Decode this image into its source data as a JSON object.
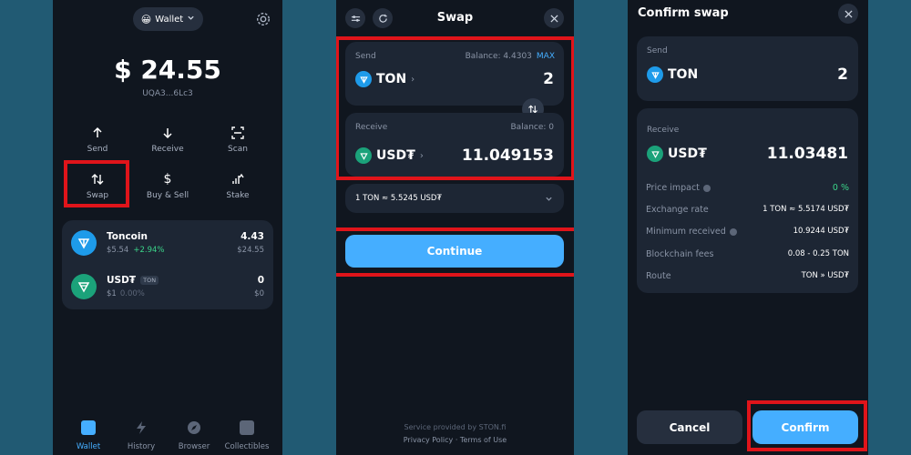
{
  "wallet": {
    "account_label": "Wallet",
    "account_emoji": "😀",
    "balance": "$ 24.55",
    "address": "UQA3...6Lc3",
    "actions": [
      {
        "label": "Send",
        "icon": "arrow-up-icon"
      },
      {
        "label": "Receive",
        "icon": "arrow-down-icon"
      },
      {
        "label": "Scan",
        "icon": "scan-icon"
      },
      {
        "label": "Swap",
        "icon": "swap-icon"
      },
      {
        "label": "Buy & Sell",
        "icon": "dollar-icon"
      },
      {
        "label": "Stake",
        "icon": "stake-icon"
      }
    ],
    "assets": [
      {
        "name": "Toncoin",
        "tag": "",
        "price": "$5.54",
        "change": "+2.94%",
        "amount": "4.43",
        "value": "$24.55"
      },
      {
        "name": "USD₮",
        "tag": "TON",
        "price": "$1",
        "change": "0.00%",
        "amount": "0",
        "value": "$0"
      }
    ],
    "tabs": [
      {
        "label": "Wallet",
        "icon": "wallet-icon"
      },
      {
        "label": "History",
        "icon": "lightning-icon"
      },
      {
        "label": "Browser",
        "icon": "compass-icon"
      },
      {
        "label": "Collectibles",
        "icon": "collectibles-icon"
      }
    ],
    "colors": {
      "positive": "#3bd58a",
      "accent": "#45aeff"
    }
  },
  "swap": {
    "title": "Swap",
    "send_label": "Send",
    "send_balance": "Balance: 4.4303",
    "max_label": "MAX",
    "send_token": "TON",
    "send_amount": "2",
    "receive_label": "Receive",
    "receive_balance": "Balance: 0",
    "receive_token": "USD₮",
    "receive_amount": "11.049153",
    "rate": "1 TON ≈ 5.5245 USD₮",
    "continue_label": "Continue",
    "footer_service": "Service provided by STON.fi",
    "footer_privacy": "Privacy Policy",
    "footer_sep": " · ",
    "footer_terms": "Terms of Use"
  },
  "confirm": {
    "title": "Confirm swap",
    "send_label": "Send",
    "send_token": "TON",
    "send_amount": "2",
    "receive_label": "Receive",
    "receive_token": "USD₮",
    "receive_amount": "11.03481",
    "details": [
      {
        "label": "Price impact",
        "value": "0 %",
        "info": true
      },
      {
        "label": "Exchange rate",
        "value": "1 TON ≈ 5.5174 USD₮",
        "info": false
      },
      {
        "label": "Minimum received",
        "value": "10.9244 USD₮",
        "info": true
      },
      {
        "label": "Blockchain fees",
        "value": "0.08 - 0.25 TON",
        "info": false
      },
      {
        "label": "Route",
        "value": "TON » USD₮",
        "info": false
      }
    ],
    "cancel_label": "Cancel",
    "confirm_label": "Confirm"
  }
}
